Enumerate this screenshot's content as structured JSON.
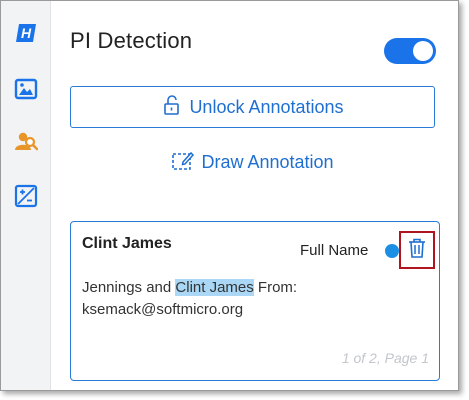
{
  "sidebar": {
    "items": [
      {
        "icon": "h-logo-icon"
      },
      {
        "icon": "image-icon"
      },
      {
        "icon": "person-search-icon"
      },
      {
        "icon": "image-edit-icon"
      }
    ]
  },
  "header": {
    "title": "PI Detection"
  },
  "toggle": {
    "state": "on",
    "color": "#1a73e8"
  },
  "actions": {
    "unlock_label": "Unlock Annotations",
    "draw_label": "Draw Annotation"
  },
  "card": {
    "name": "Clint James",
    "type": "Full Name",
    "type_color": "#1a8fe3",
    "snippet_before": "Jennings and ",
    "snippet_highlight": "Clint James",
    "snippet_after": " From: ksemack@softmicro.org",
    "pager": "1 of 2, Page 1"
  },
  "colors": {
    "accent": "#1f6fd1",
    "highlight": "#a9d7f5",
    "delete_outline": "#b0151f"
  }
}
